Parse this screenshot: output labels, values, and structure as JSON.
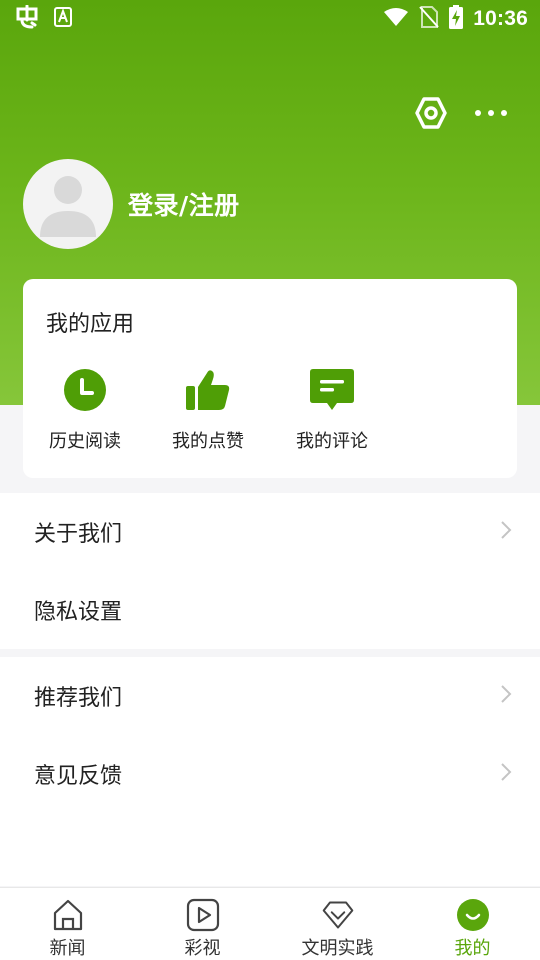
{
  "colors": {
    "brand_green": "#5aa60c",
    "icon_green": "#4f9e06",
    "text_primary": "#222222",
    "chevron_gray": "#c4c4c4"
  },
  "status_bar": {
    "time": "10:36",
    "icons": [
      "bug-app-icon",
      "a-app-icon",
      "wifi-icon",
      "no-sim-icon",
      "battery-charging-icon"
    ]
  },
  "header": {
    "actions": [
      "settings-icon",
      "more-icon"
    ],
    "login_label": "登录/注册"
  },
  "my_apps": {
    "title": "我的应用",
    "items": [
      {
        "label": "历史阅读",
        "icon": "clock-icon"
      },
      {
        "label": "我的点赞",
        "icon": "thumbs-up-icon"
      },
      {
        "label": "我的评论",
        "icon": "comment-icon"
      }
    ]
  },
  "menu": {
    "group1": [
      {
        "label": "关于我们",
        "has_chevron": true
      },
      {
        "label": "隐私设置",
        "has_chevron": false
      }
    ],
    "group2": [
      {
        "label": "推荐我们",
        "has_chevron": true
      },
      {
        "label": "意见反馈",
        "has_chevron": true
      }
    ]
  },
  "bottom_nav": {
    "items": [
      {
        "label": "新闻",
        "icon": "home-icon",
        "active": false
      },
      {
        "label": "彩视",
        "icon": "play-icon",
        "active": false
      },
      {
        "label": "文明实践",
        "icon": "heart-icon",
        "active": false
      },
      {
        "label": "我的",
        "icon": "smile-icon",
        "active": true
      }
    ]
  }
}
